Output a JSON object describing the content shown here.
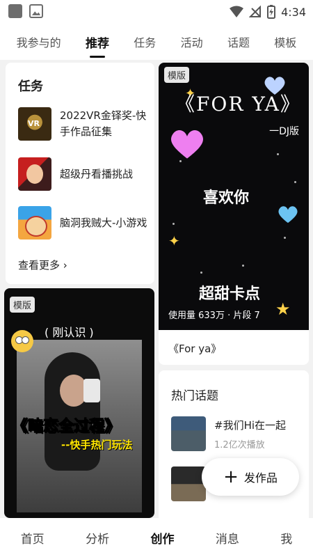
{
  "status_bar": {
    "time": "4:34"
  },
  "tabs": [
    {
      "label": "我参与的"
    },
    {
      "label": "推荐"
    },
    {
      "label": "任务"
    },
    {
      "label": "活动"
    },
    {
      "label": "话题"
    },
    {
      "label": "模板"
    }
  ],
  "active_tab": "推荐",
  "task_section": {
    "title": "任务",
    "items": [
      {
        "label": "2022VR金铎奖-快手作品征集"
      },
      {
        "label": "超级丹看播挑战"
      },
      {
        "label": "脑洞我贼大-小游戏"
      }
    ],
    "see_more": "查看更多 ›"
  },
  "template_poster": {
    "badge": "模版",
    "title": "《FOR YA》",
    "subtitle": "一DJ版",
    "line1": "喜欢你",
    "line2": "超甜卡点",
    "stats": "使用量 633万 · 片段 7",
    "caption": "《For ya》"
  },
  "template_video": {
    "badge": "模版",
    "tag": "( 刚认识 )",
    "title": "《暗恋全过程》",
    "subtitle": "--快手热门玩法"
  },
  "hot_topics": {
    "title": "热门话题",
    "items": [
      {
        "name": "#我们Hi在一起",
        "plays": "1.2亿次播放"
      },
      {
        "name": "",
        "plays": ""
      }
    ]
  },
  "fab": {
    "label": "发作品"
  },
  "bottom_nav": [
    {
      "label": "首页"
    },
    {
      "label": "分析"
    },
    {
      "label": "创作"
    },
    {
      "label": "消息"
    },
    {
      "label": "我"
    }
  ],
  "active_nav": "创作",
  "colors": {
    "accent_text": "#111111",
    "yellow_caption": "#ffe600"
  }
}
